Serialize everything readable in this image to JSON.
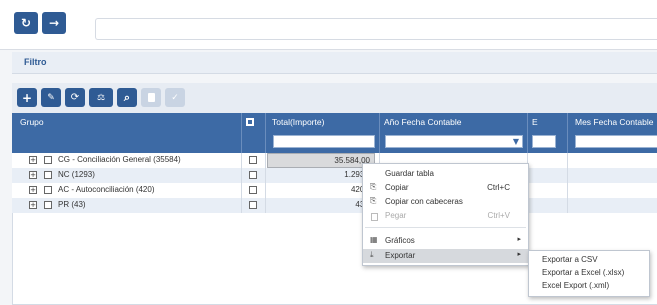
{
  "topbar": {
    "refresh_icon": "↻",
    "forward_icon": "→"
  },
  "filter": {
    "label": "Filtro"
  },
  "toolbar": {
    "buttons": [
      {
        "icon": "+",
        "name": "add"
      },
      {
        "icon": "✎",
        "name": "edit"
      },
      {
        "icon": "⟳",
        "name": "refresh"
      },
      {
        "icon": "⚖",
        "name": "compare"
      },
      {
        "icon": "⌕",
        "name": "search"
      },
      {
        "icon": "🗑",
        "name": "delete"
      },
      {
        "icon": "✓",
        "name": "confirm"
      }
    ]
  },
  "grid": {
    "headers": {
      "grupo": "Grupo",
      "select_all": "■",
      "total": "Total(Importe)",
      "anio": "Año Fecha Contable",
      "e": "E",
      "mes": "Mes Fecha Contable"
    },
    "rows": [
      {
        "group": "CG - Conciliación General (35584)",
        "total": "35.584,00"
      },
      {
        "group": "NC (1293)",
        "total": "1.293,0"
      },
      {
        "group": "AC - Autoconciliación (420)",
        "total": "420,0"
      },
      {
        "group": "PR (43)",
        "total": "43,0"
      }
    ]
  },
  "context_menu": {
    "items": [
      {
        "label": "Guardar tabla",
        "icon": "",
        "shortcut": ""
      },
      {
        "label": "Copiar",
        "icon": "⎘",
        "shortcut": "Ctrl+C"
      },
      {
        "label": "Copiar con cabeceras",
        "icon": "⎘",
        "shortcut": ""
      },
      {
        "label": "Pegar",
        "icon": "📋",
        "shortcut": "Ctrl+V"
      },
      {
        "label": "Gráficos",
        "icon": "▦",
        "shortcut": ""
      },
      {
        "label": "Exportar",
        "icon": "⤓",
        "shortcut": ""
      }
    ],
    "arrow": "▸"
  },
  "submenu": {
    "items": [
      "Exportar a CSV",
      "Exportar a Excel (.xlsx)",
      "Excel Export (.xml)"
    ]
  },
  "colors": {
    "accent": "#2f5b94",
    "header_bg": "#3d6aa5",
    "row_alt": "#e8eef6",
    "highlight": "#d6d9dd"
  }
}
